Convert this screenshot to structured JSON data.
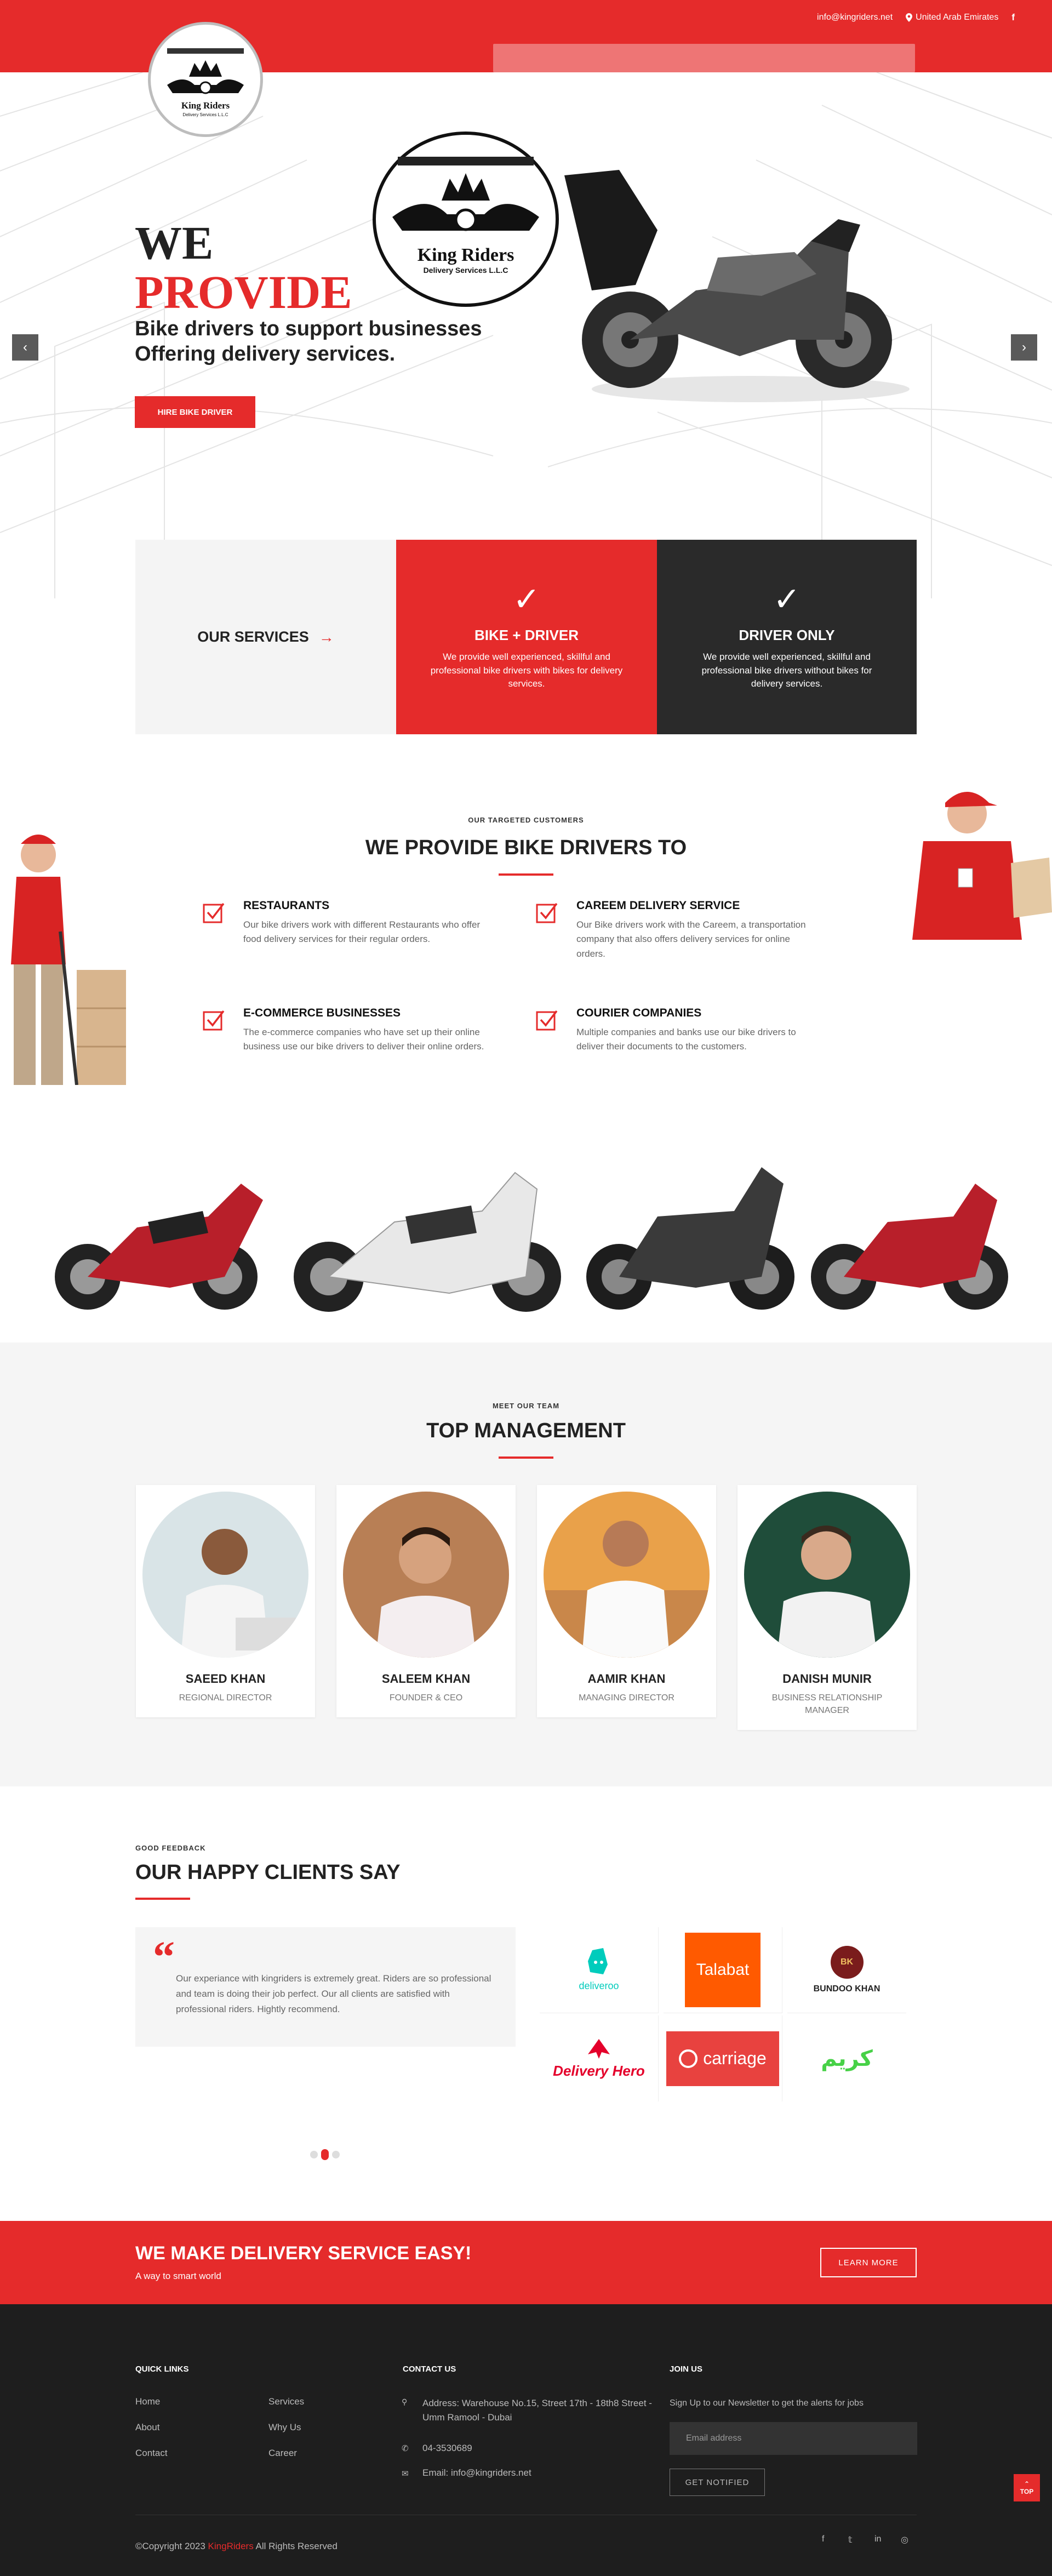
{
  "topbar": {
    "email": "info@kingriders.net",
    "location": "United Arab Emirates",
    "facebook_icon": "facebook-icon"
  },
  "brand": {
    "logo_name": "King Riders",
    "logo_sub": "Delivery Services L.L.C",
    "accent": "#e52b2b",
    "dark": "#2a2a2a"
  },
  "hero": {
    "line1": "WE",
    "line2": "PROVIDE",
    "subtitle": "Bike drivers to support businesses Offering delivery services.",
    "button": "HIRE BIKE DRIVER"
  },
  "services": {
    "label": "OUR SERVICES",
    "items": [
      {
        "title": "BIKE + DRIVER",
        "text": "We provide well experienced, skillful and professional bike drivers with bikes for delivery services."
      },
      {
        "title": "DRIVER ONLY",
        "text": "We provide well experienced, skillful and professional bike drivers without bikes for delivery services."
      }
    ]
  },
  "targeted": {
    "kicker": "OUR TARGETED CUSTOMERS",
    "title": "WE PROVIDE BIKE DRIVERS TO",
    "items": [
      {
        "title": "RESTAURANTS",
        "text": "Our bike drivers work with different Restaurants who offer food delivery services for their regular orders."
      },
      {
        "title": "CAREEM DELIVERY SERVICE",
        "text": "Our Bike drivers work with the Careem, a transportation company that also offers delivery services for online orders."
      },
      {
        "title": "E-COMMERCE BUSINESSES",
        "text": "The e-commerce companies who have set up their online business use our bike drivers to deliver their online orders."
      },
      {
        "title": "COURIER COMPANIES",
        "text": "Multiple companies and banks use our bike drivers to deliver their documents to the customers."
      }
    ]
  },
  "team": {
    "kicker": "MEET OUR TEAM",
    "title": "TOP MANAGEMENT",
    "members": [
      {
        "name": "SAEED KHAN",
        "role": "REGIONAL DIRECTOR"
      },
      {
        "name": "SALEEM KHAN",
        "role": "FOUNDER & CEO"
      },
      {
        "name": "AAMIR KHAN",
        "role": "MANAGING DIRECTOR"
      },
      {
        "name": "DANISH MUNIR",
        "role": "BUSINESS RELATIONSHIP MANAGER"
      }
    ]
  },
  "clients": {
    "kicker": "GOOD FEEDBACK",
    "title": "OUR HAPPY CLIENTS SAY",
    "quote": "Our experiance with kingriders is extremely great. Riders are so professional and team is doing their job perfect. Our all clients are satisfied with professional riders. Hightly recommend.",
    "logos": [
      "deliveroo",
      "Talabat",
      "BUNDOO KHAN",
      "Delivery Hero",
      "carriage",
      "كريم"
    ]
  },
  "cta": {
    "title": "WE MAKE DELIVERY SERVICE EASY!",
    "subtitle": "A way to smart world",
    "button": "LEARN MORE"
  },
  "footer": {
    "quick_links_title": "QUICK LINKS",
    "links_col1": [
      "Home",
      "About",
      "Contact"
    ],
    "links_col2": [
      "Services",
      "Why Us",
      "Career"
    ],
    "contact_title": "CONTACT US",
    "address": "Address: Warehouse No.15, Street 17th - 18th8 Street - Umm Ramool - Dubai",
    "phone": "04-3530689",
    "email": "Email: info@kingriders.net",
    "join_title": "JOIN US",
    "join_text": "Sign Up to our Newsletter to get the alerts for jobs",
    "email_placeholder": "Email address",
    "notify_button": "GET NOTIFIED",
    "copyright_prefix": "©Copyright 2023 ",
    "copyright_brand": "KingRiders",
    "copyright_suffix": " All Rights Reserved",
    "to_top": "TOP"
  }
}
